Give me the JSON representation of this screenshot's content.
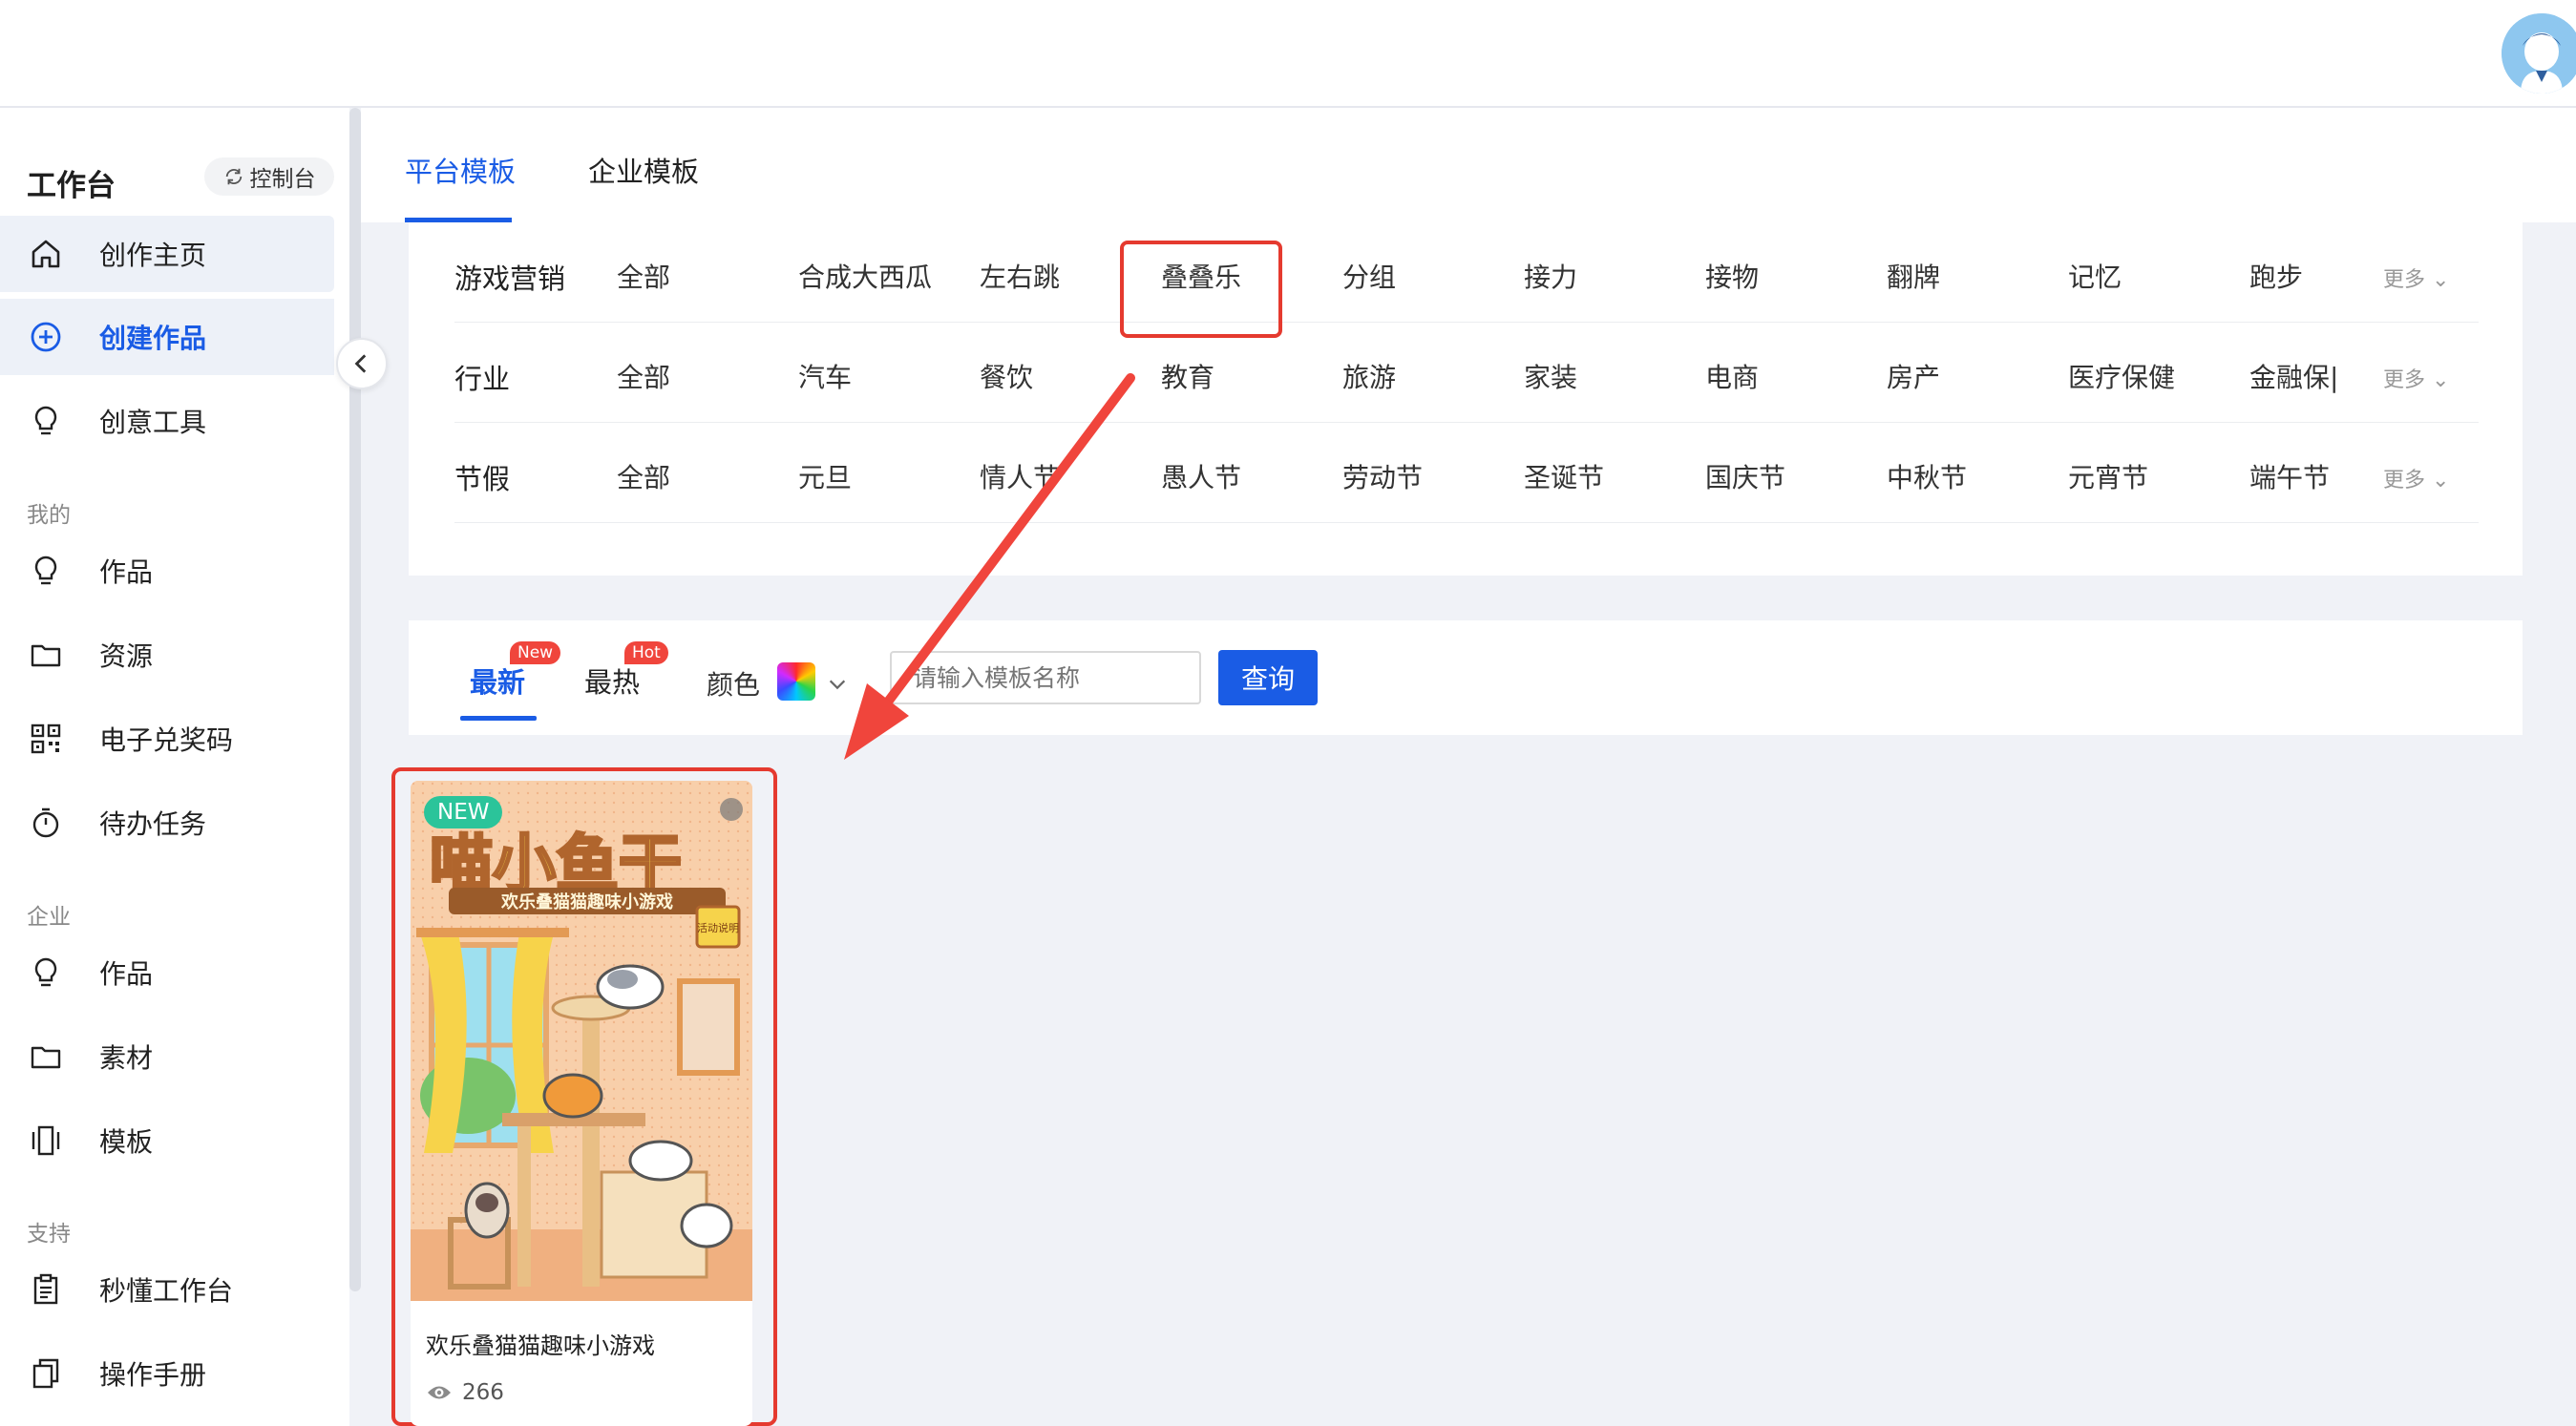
{
  "sidebar": {
    "title": "工作台",
    "console_label": "控制台",
    "items_main": [
      {
        "label": "创作主页",
        "icon": "home-icon"
      },
      {
        "label": "创建作品",
        "icon": "plus-circle-icon"
      },
      {
        "label": "创意工具",
        "icon": "lightbulb-icon"
      }
    ],
    "section_mine": "我的",
    "items_mine": [
      {
        "label": "作品",
        "icon": "lightbulb-icon"
      },
      {
        "label": "资源",
        "icon": "folder-icon"
      },
      {
        "label": "电子兑奖码",
        "icon": "qrcode-icon"
      },
      {
        "label": "待办任务",
        "icon": "timer-icon"
      }
    ],
    "section_enterprise": "企业",
    "items_enterprise": [
      {
        "label": "作品",
        "icon": "lightbulb-icon"
      },
      {
        "label": "素材",
        "icon": "folder-icon"
      },
      {
        "label": "模板",
        "icon": "template-icon"
      }
    ],
    "section_support": "支持",
    "items_support": [
      {
        "label": "秒懂工作台",
        "icon": "clipboard-icon"
      },
      {
        "label": "操作手册",
        "icon": "copy-icon"
      }
    ]
  },
  "tabs": [
    {
      "label": "平台模板",
      "active": true
    },
    {
      "label": "企业模板",
      "active": false
    }
  ],
  "filters": [
    {
      "label": "游戏营销",
      "options": [
        "全部",
        "合成大西瓜",
        "左右跳",
        "叠叠乐",
        "分组",
        "接力",
        "接物",
        "翻牌",
        "记忆",
        "跑步"
      ],
      "more": "更多"
    },
    {
      "label": "行业",
      "options": [
        "全部",
        "汽车",
        "餐饮",
        "教育",
        "旅游",
        "家装",
        "电商",
        "房产",
        "医疗保健",
        "金融保|"
      ],
      "more": "更多"
    },
    {
      "label": "节假",
      "options": [
        "全部",
        "元旦",
        "情人节",
        "愚人节",
        "劳动节",
        "圣诞节",
        "国庆节",
        "中秋节",
        "元宵节",
        "端午节"
      ],
      "more": "更多"
    }
  ],
  "sort": {
    "latest": "最新",
    "latest_badge": "New",
    "hottest": "最热",
    "hottest_badge": "Hot",
    "color_label": "颜色",
    "search_placeholder": "请输入模板名称",
    "query_label": "查询"
  },
  "cards": [
    {
      "badge": "NEW",
      "title": "欢乐叠猫猫趣味小游戏",
      "views": "266",
      "thumb_title": "喵小鱼干",
      "thumb_subtitle": "欢乐叠猫猫趣味小游戏",
      "thumb_tag": "活动说明"
    }
  ],
  "colors": {
    "accent": "#1a5ce5",
    "annotation_red": "#e53a2f",
    "badge_green": "#2bc49a"
  }
}
